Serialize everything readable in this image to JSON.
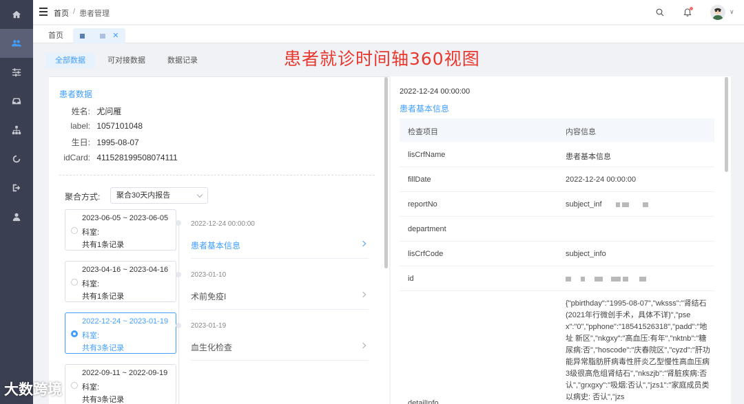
{
  "sidebar": {
    "items": [
      {
        "icon": "home-icon"
      },
      {
        "icon": "users-icon"
      },
      {
        "icon": "sliders-icon"
      },
      {
        "icon": "inbox-icon"
      },
      {
        "icon": "sitemap-icon"
      },
      {
        "icon": "refresh-icon"
      },
      {
        "icon": "sign-out-icon"
      },
      {
        "icon": "user-icon"
      }
    ],
    "active_index": 1
  },
  "header": {
    "breadcrumb_home": "首页",
    "breadcrumb_sep": "/",
    "breadcrumb_current": "患者管理"
  },
  "tabs": {
    "home": "首页",
    "close": "✕"
  },
  "subtabs": [
    "全部数据",
    "可对接数据",
    "数据记录"
  ],
  "overlay_title": "患者就诊时间轴360视图",
  "patient": {
    "section_title": "患者数据",
    "name_label": "姓名:",
    "name": "尤问雁",
    "label_label": "label:",
    "label": "1057101048",
    "birthday_label": "生日:",
    "birthday": "1995-08-07",
    "idcard_label": "idCard:",
    "idcard": "411528199508074111"
  },
  "aggregation": {
    "label": "聚合方式:",
    "selected": "聚合30天内报告"
  },
  "groups": [
    {
      "range": "2023-06-05 ~ 2023-06-05",
      "dept": "科室:",
      "count": "共有1条记录",
      "selected": false
    },
    {
      "range": "2023-04-16 ~ 2023-04-16",
      "dept": "科室:",
      "count": "共有1条记录",
      "selected": false
    },
    {
      "range": "2022-12-24 ~ 2023-01-19",
      "dept": "科室:",
      "count": "共有3条记录",
      "selected": true
    },
    {
      "range": "2022-09-11 ~ 2022-09-19",
      "dept": "科室:",
      "count": "共有3条记录",
      "selected": false
    }
  ],
  "timeline": [
    {
      "date": "2022-12-24 00:00:00",
      "title": "患者基本信息",
      "active": true
    },
    {
      "date": "2023-01-10",
      "title": "术前免疫I",
      "active": false
    },
    {
      "date": "2023-01-19",
      "title": "血生化检查",
      "active": false
    }
  ],
  "detail": {
    "date": "2022-12-24 00:00:00",
    "title": "患者基本信息",
    "col_item": "检查项目",
    "col_content": "内容信息",
    "rows": [
      {
        "key": "lisCrfName",
        "value": "患者基本信息"
      },
      {
        "key": "fillDate",
        "value": "2022-12-24 00:00:00"
      },
      {
        "key": "reportNo",
        "value": "subject_inf"
      },
      {
        "key": "department",
        "value": ""
      },
      {
        "key": "lisCrfCode",
        "value": "subject_info"
      },
      {
        "key": "id",
        "value": ""
      }
    ],
    "detail_info_key": "detailInfo",
    "detail_info_value": "{\"pbirthday\":\"1995-08-07\",\"wksss\":\"肾结石(2021年行微创手术，具体不详)\",\"psex\":\"0\",\"pphone\":\"18541526318\",\"padd\":\"地址 新区\",\"nkgxy\":\"高血压:有年\",\"nktnb\":\"糖尿病:否\",\"hoscode\":\"庆春院区\",\"cyzd\":\"肝功能异常脂肪肝病毒性肝炎乙型慢性高血压病3级很高危组肾结石\",\"nkszjb\":\"肾脏疾病:否认\",\"grxgxy\":\"吸烟:否认\",\"jzs1\":\"家庭成员类以病史: 否认\",\"jzs"
  },
  "watermark": "大数跨境"
}
